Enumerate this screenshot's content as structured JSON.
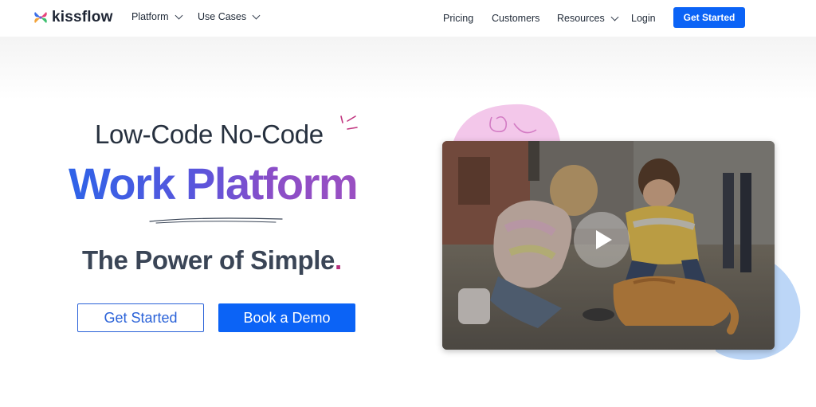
{
  "brand": {
    "name": "kissflow"
  },
  "nav": {
    "left_items": [
      {
        "label": "Platform",
        "has_dropdown": true
      },
      {
        "label": "Use Cases",
        "has_dropdown": true
      }
    ],
    "right_items": [
      {
        "label": "Pricing",
        "has_dropdown": false
      },
      {
        "label": "Customers",
        "has_dropdown": false
      },
      {
        "label": "Resources",
        "has_dropdown": true
      },
      {
        "label": "Login",
        "has_dropdown": false
      }
    ],
    "cta_label": "Get Started"
  },
  "hero": {
    "tagline": "Low-Code No-Code",
    "headline": "Work Platform",
    "subheadline": "The Power of Simple",
    "subheadline_dot": ".",
    "primary_button": "Book a Demo",
    "secondary_button": "Get Started",
    "video_icon": "play-icon"
  },
  "colors": {
    "accent_blue": "#0b63f6",
    "headline_gradient_start": "#2e63e8",
    "headline_gradient_end": "#9a4fc2",
    "dot_magenta": "#b5307a",
    "blob_pink": "#f3c7ea",
    "blob_blue": "#bcd6f7"
  }
}
